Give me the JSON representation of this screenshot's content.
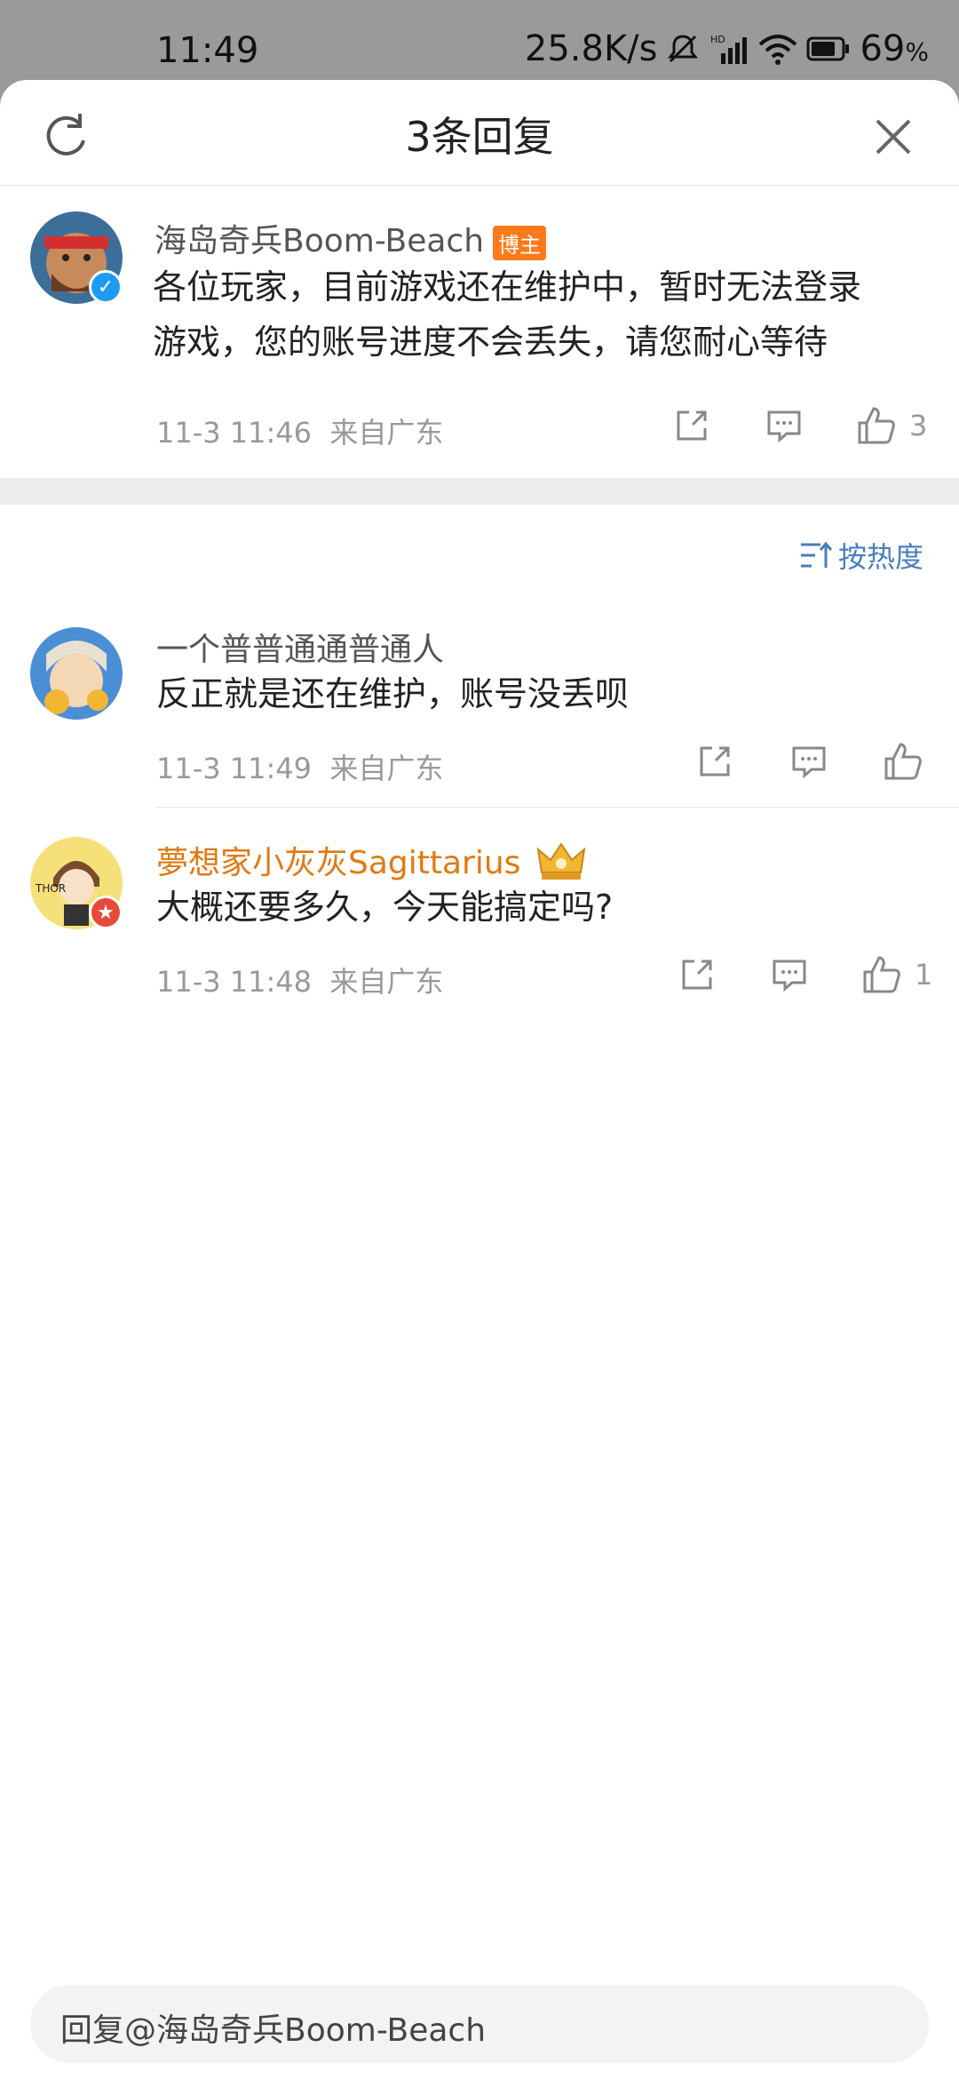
{
  "status_bar": {
    "time": "11:49",
    "net_speed": "25.8K/s",
    "battery": "69",
    "battery_unit": "%",
    "icons": [
      "mute-bell-icon",
      "hd-signal-icon",
      "wifi-icon",
      "battery-icon"
    ]
  },
  "header": {
    "title": "3条回复",
    "left_icon": "refresh-icon",
    "right_icon": "close-icon"
  },
  "main_comment": {
    "username": "海岛奇兵Boom-Beach",
    "tag": "博主",
    "text_line1": "各位玩家，目前游戏还在维护中，暂时无法登录",
    "text_line2": "游戏，您的账号进度不会丢失，请您耐心等待",
    "time": "11-3 11:46",
    "location": "来自广东",
    "likes": "3"
  },
  "sort": {
    "label": "按热度"
  },
  "replies": [
    {
      "username": "一个普普通通普通人",
      "text": "反正就是还在维护，账号没丢呗",
      "time": "11-3 11:49",
      "location": "来自广东",
      "likes": ""
    },
    {
      "username": "夢想家小灰灰Sagittarius",
      "text": "大概还要多久，今天能搞定吗?",
      "time": "11-3 11:48",
      "location": "来自广东",
      "likes": "1"
    }
  ],
  "reply_box": {
    "placeholder": "回复@海岛奇兵Boom-Beach"
  },
  "colors": {
    "accent_blue": "#4a7ebb",
    "vip_orange": "#e07a10",
    "tag_orange": "#ff7a1a",
    "verified_blue": "#1d9bf0"
  }
}
